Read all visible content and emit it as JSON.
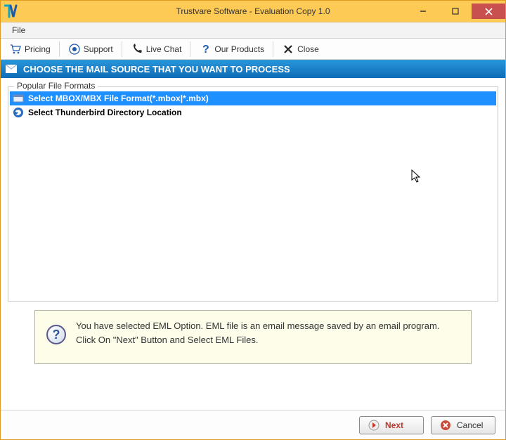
{
  "window": {
    "title": "Trustvare Software - Evaluation Copy 1.0"
  },
  "menubar": {
    "file": "File"
  },
  "toolbar": {
    "pricing": "Pricing",
    "support": "Support",
    "livechat": "Live Chat",
    "products": "Our Products",
    "close": "Close"
  },
  "banner": {
    "text": "CHOOSE THE MAIL SOURCE THAT YOU WANT TO PROCESS"
  },
  "group": {
    "legend": "Popular File Formats"
  },
  "options": {
    "mbox": "Select MBOX/MBX File Format(*.mbox|*.mbx)",
    "thunderbird": "Select Thunderbird Directory Location"
  },
  "info": {
    "text": "You have selected EML Option. EML file is an email message saved by an email program. Click On \"Next\" Button and Select EML Files."
  },
  "footer": {
    "next": "Next",
    "cancel": "Cancel"
  }
}
